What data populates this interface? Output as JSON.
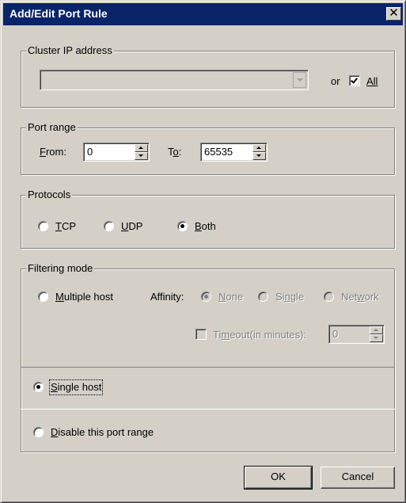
{
  "window": {
    "title": "Add/Edit Port Rule",
    "close_glyph": "✕"
  },
  "cluster": {
    "legend": "Cluster IP address",
    "combo_value": "",
    "or_label": "or",
    "all_label": "All",
    "all_checked": true
  },
  "port_range": {
    "legend": "Port range",
    "from_label": "From:",
    "from_value": "0",
    "to_label": "To:",
    "to_value": "65535"
  },
  "protocols": {
    "legend": "Protocols",
    "tcp": "TCP",
    "udp": "UDP",
    "both": "Both",
    "selected": "both"
  },
  "filtering": {
    "legend": "Filtering mode",
    "multiple_host": "Multiple host",
    "affinity_label": "Affinity:",
    "affinity_none": "None",
    "affinity_single": "Single",
    "affinity_network": "Network",
    "timeout_label": "Timeout(in minutes):",
    "timeout_value": "0",
    "single_host": "Single host",
    "disable": "Disable this port range",
    "selected": "single_host"
  },
  "buttons": {
    "ok": "OK",
    "cancel": "Cancel"
  },
  "colors": {
    "dialog_bg": "#d4d0c8",
    "titlebar": "#0a246a",
    "disabled_text": "#808080"
  }
}
